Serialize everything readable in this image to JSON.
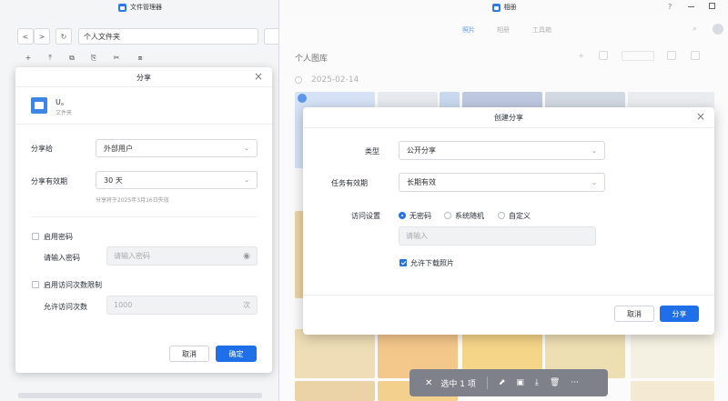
{
  "file_manager": {
    "title": "文件管理器",
    "nav_back": "<",
    "nav_forward": ">",
    "refresh": "↻",
    "path": "个人文件夹",
    "toolbar": [
      "+",
      "⤒",
      "⧉",
      "⎘",
      "✂",
      "⧈"
    ]
  },
  "share_dialog": {
    "title": "分享",
    "folder_name": "U。",
    "folder_type": "文件夹",
    "share_to_label": "分享给",
    "share_to_value": "外部用户",
    "validity_label": "分享有效期",
    "validity_value": "30 天",
    "expiry_note": "分享将于2025年3月16日失效",
    "enable_password_label": "启用密码",
    "password_label": "请输入密码",
    "password_placeholder": "请输入密码",
    "enable_access_limit_label": "启用访问次数限制",
    "allowed_count_label": "允许访问次数",
    "allowed_count_value": "1000",
    "allowed_count_unit": "次",
    "cancel": "取消",
    "confirm": "确定",
    "close": "×"
  },
  "photos": {
    "title": "相册",
    "help": "?",
    "tabs": [
      "照片",
      "相册",
      "工具箱"
    ],
    "library_title": "个人图库",
    "date": "2025-02-14"
  },
  "create_share_dialog": {
    "title": "创建分享",
    "close": "×",
    "type_label": "类型",
    "type_value": "公开分享",
    "validity_label": "任务有效期",
    "validity_value": "长期有效",
    "access_label": "访问设置",
    "access_options": [
      "无密码",
      "系统随机",
      "自定义"
    ],
    "input_placeholder": "请输入",
    "allow_download_label": "允许下载照片",
    "cancel": "取消",
    "share": "分享"
  },
  "selection_bar": {
    "close": "✕",
    "label": "选中 1 项",
    "more": "···"
  },
  "colors": {
    "accent": "#1f6fe8",
    "overlay_bar": "#7e8189"
  }
}
